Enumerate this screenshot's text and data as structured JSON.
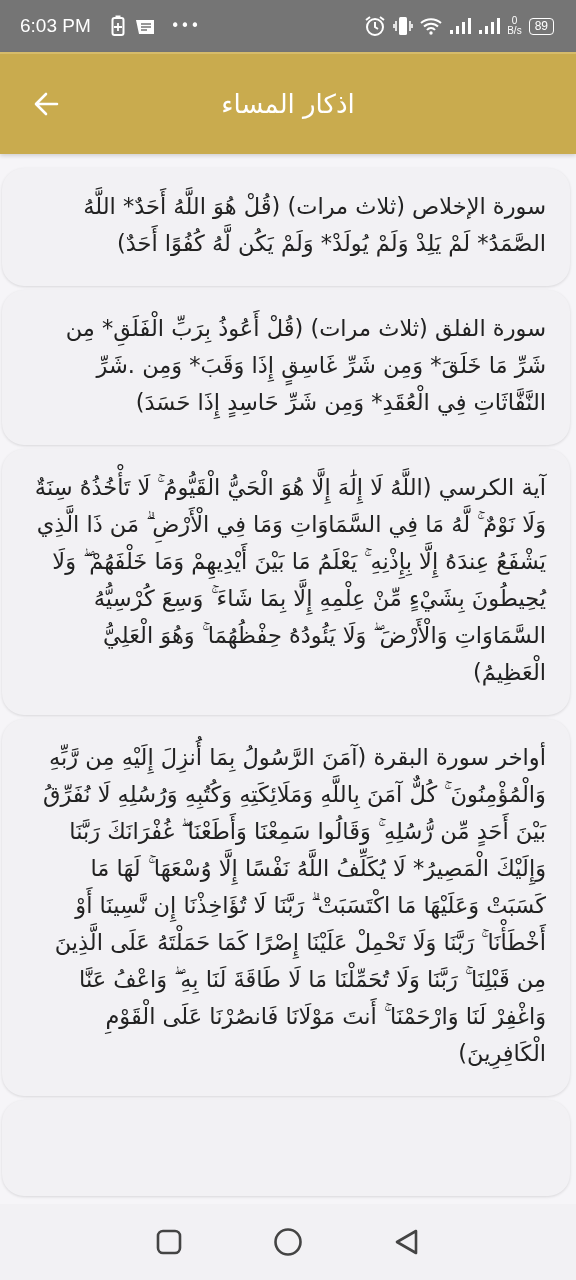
{
  "status_bar": {
    "time": "6:03 PM",
    "more": "•••",
    "speed_value": "0",
    "speed_unit": "B/s",
    "battery": "89"
  },
  "app_bar": {
    "title": "اذكار المساء"
  },
  "cards": [
    {
      "text": "سورة الإخلاص (ثلاث مرات) (قُلْ هُوَ اللَّهُ أَحَدٌ* اللَّهُ الصَّمَدُ* لَمْ يَلِدْ وَلَمْ يُولَدْ* وَلَمْ يَكُن لَّهُ كُفُوًا أَحَدٌ)"
    },
    {
      "text": "سورة الفلق (ثلاث مرات) (قُلْ أَعُوذُ بِرَبِّ الْفَلَقِ* مِن شَرِّ مَا خَلَقَ* وَمِن شَرِّ غَاسِقٍ إِذَا وَقَبَ* وَمِن .شَرِّ النَّفَّاثَاتِ فِي الْعُقَدِ* وَمِن شَرِّ حَاسِدٍ إِذَا حَسَدَ)"
    },
    {
      "text": "آية الكرسي (اللَّهُ لَا إِلَٰهَ إِلَّا هُوَ الْحَيُّ الْقَيُّومُ ۚ لَا تَأْخُذُهُ سِنَةٌ وَلَا نَوْمٌ ۚ لَّهُ مَا فِي السَّمَاوَاتِ وَمَا فِي الْأَرْضِ ۗ مَن ذَا الَّذِي يَشْفَعُ عِندَهُ إِلَّا بِإِذْنِهِ ۚ يَعْلَمُ مَا بَيْنَ أَيْدِيهِمْ وَمَا خَلْفَهُمْ ۖ وَلَا يُحِيطُونَ بِشَيْءٍ مِّنْ عِلْمِهِ إِلَّا بِمَا شَاءَ ۚ وَسِعَ كُرْسِيُّهُ السَّمَاوَاتِ وَالْأَرْضَ ۖ وَلَا يَئُودُهُ حِفْظُهُمَا ۚ وَهُوَ الْعَلِيُّ الْعَظِيمُ)"
    },
    {
      "text": "أواخر سورة البقرة (آمَنَ الرَّسُولُ بِمَا أُنزِلَ إِلَيْهِ مِن رَّبِّهِ وَالْمُؤْمِنُونَ ۚ كُلٌّ آمَنَ بِاللَّهِ وَمَلَائِكَتِهِ وَكُتُبِهِ وَرُسُلِهِ لَا نُفَرِّقُ بَيْنَ أَحَدٍ مِّن رُّسُلِهِ ۚ وَقَالُوا سَمِعْنَا وَأَطَعْنَا ۖ غُفْرَانَكَ رَبَّنَا وَإِلَيْكَ الْمَصِيرُ* لَا يُكَلِّفُ اللَّهُ نَفْسًا إِلَّا وُسْعَهَا ۚ لَهَا مَا كَسَبَتْ وَعَلَيْهَا مَا اكْتَسَبَتْ ۗ رَبَّنَا لَا تُؤَاخِذْنَا إِن نَّسِينَا أَوْ أَخْطَأْنَا ۚ رَبَّنَا وَلَا تَحْمِلْ عَلَيْنَا إِصْرًا كَمَا حَمَلْتَهُ عَلَى الَّذِينَ مِن قَبْلِنَا ۚ رَبَّنَا وَلَا تُحَمِّلْنَا مَا لَا طَاقَةَ لَنَا بِهِ ۖ وَاعْفُ عَنَّا وَاغْفِرْ لَنَا وَارْحَمْنَا ۚ أَنتَ مَوْلَانَا فَانصُرْنَا عَلَى الْقَوْمِ الْكَافِرِينَ)"
    }
  ]
}
